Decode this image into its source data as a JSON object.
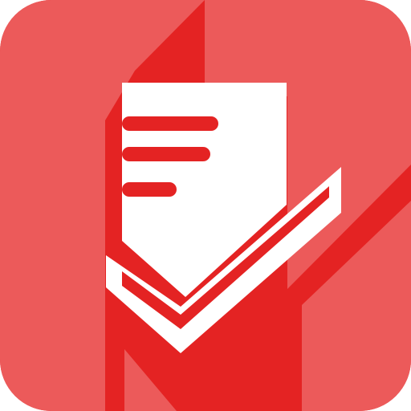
{
  "app_icon": {
    "icon_name": "document-check-icon",
    "colors": {
      "base_red": "#E42323",
      "light_red": "#EC5A5A",
      "white": "#FFFFFF"
    }
  }
}
